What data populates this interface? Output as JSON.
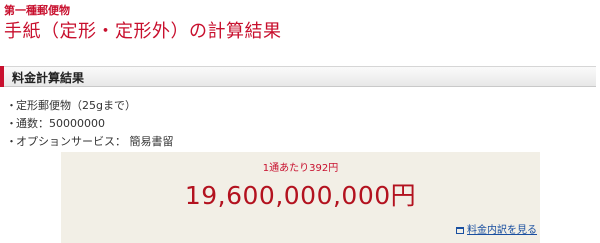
{
  "header": {
    "category": "第一種郵便物",
    "title": "手紙（定形・定形外）の計算結果"
  },
  "section": {
    "title": "料金計算結果"
  },
  "details": {
    "bullet": "・",
    "items": [
      "定形郵便物（25gまで）",
      "通数：50000000",
      "オプションサービス： 簡易書留"
    ]
  },
  "result": {
    "unit_price": "1通あたり392円",
    "total": "19,600,000,000円",
    "breakdown_link": "料金内訳を見る"
  },
  "colors": {
    "accent": "#c8102e",
    "link": "#1a4fa0",
    "result_bg": "#f2efe6"
  }
}
